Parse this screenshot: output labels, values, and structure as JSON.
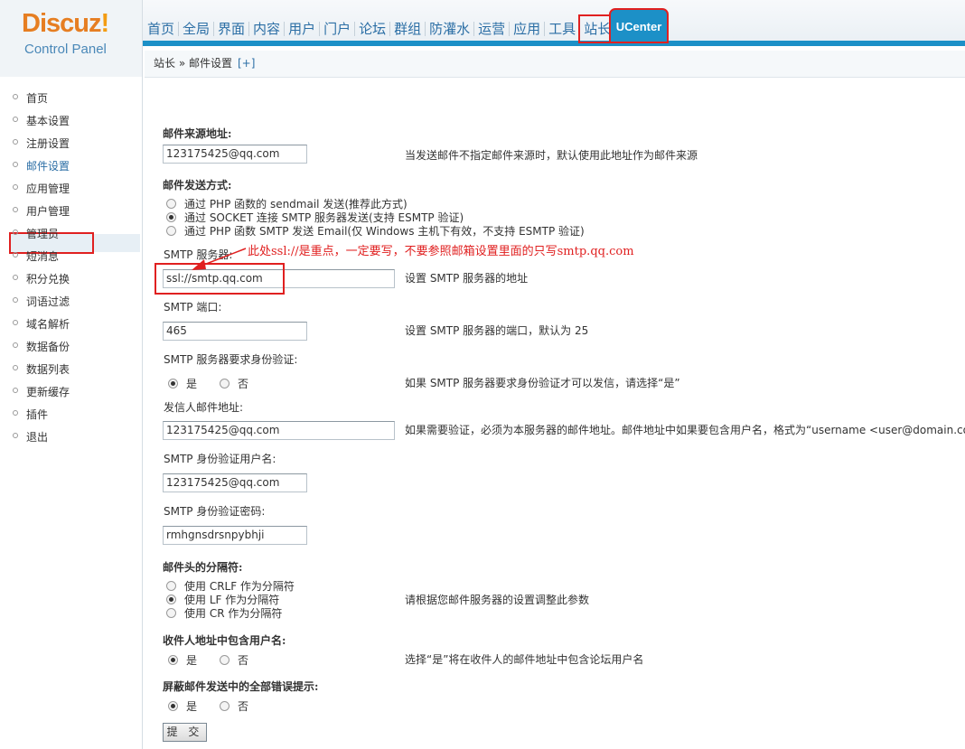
{
  "logo": {
    "brand": "Discuz",
    "bang": "!",
    "subtitle": "Control Panel"
  },
  "nav": {
    "items": [
      "首页",
      "全局",
      "界面",
      "内容",
      "用户",
      "门户",
      "论坛",
      "群组",
      "防灌水",
      "运营",
      "应用",
      "工具",
      "站长"
    ],
    "ucenter": "UCenter",
    "active": "站长"
  },
  "breadcrumb": {
    "text": "站长 » 邮件设置",
    "plus": "[+]"
  },
  "sidebar": {
    "items": [
      "首页",
      "基本设置",
      "注册设置",
      "邮件设置",
      "应用管理",
      "用户管理",
      "管理员",
      "短消息",
      "积分兑换",
      "词语过滤",
      "域名解析",
      "数据备份",
      "数据列表",
      "更新缓存",
      "插件",
      "退出"
    ],
    "active": "邮件设置"
  },
  "form": {
    "from_label": "邮件来源地址:",
    "from_value": "123175425@qq.com",
    "from_tip": "当发送邮件不指定邮件来源时，默认使用此地址作为邮件来源",
    "method_label": "邮件发送方式:",
    "method_options": [
      "通过 PHP 函数的 sendmail 发送(推荐此方式)",
      "通过 SOCKET 连接 SMTP 服务器发送(支持 ESMTP 验证)",
      "通过 PHP 函数 SMTP 发送 Email(仅 Windows 主机下有效，不支持 ESMTP 验证)"
    ],
    "method_selected": 1,
    "smtp_server_label": "SMTP 服务器:",
    "annotation": "此处ssl://是重点，一定要写，不要参照邮箱设置里面的只写smtp.qq.com",
    "smtp_server_value": "ssl://smtp.qq.com",
    "smtp_server_tip": "设置 SMTP 服务器的地址",
    "smtp_port_label": "SMTP 端口:",
    "smtp_port_value": "465",
    "smtp_port_tip": "设置 SMTP 服务器的端口，默认为 25",
    "auth_label": "SMTP 服务器要求身份验证:",
    "yes": "是",
    "no": "否",
    "auth_tip": "如果 SMTP 服务器要求身份验证才可以发信，请选择“是”",
    "sender_label": "发信人邮件地址:",
    "sender_value": "123175425@qq.com",
    "sender_tip": "如果需要验证，必须为本服务器的邮件地址。邮件地址中如果要包含用户名，格式为“username <user@domain.co",
    "user_label": "SMTP 身份验证用户名:",
    "user_value": "123175425@qq.com",
    "pass_label": "SMTP 身份验证密码:",
    "pass_value": "rmhgnsdrsnpybhji",
    "sep_label": "邮件头的分隔符:",
    "sep_options": [
      "使用 CRLF 作为分隔符",
      "使用 LF 作为分隔符",
      "使用 CR 作为分隔符"
    ],
    "sep_selected": 1,
    "sep_tip": "请根据您邮件服务器的设置调整此参数",
    "include_user_label": "收件人地址中包含用户名:",
    "include_user_tip": "选择“是”将在收件人的邮件地址中包含论坛用户名",
    "silent_label": "屏蔽邮件发送中的全部错误提示:",
    "submit": "提 交"
  },
  "colors": {
    "accent": "#1c90c7",
    "highlight": "#e02020",
    "logo": "#e67e22"
  }
}
